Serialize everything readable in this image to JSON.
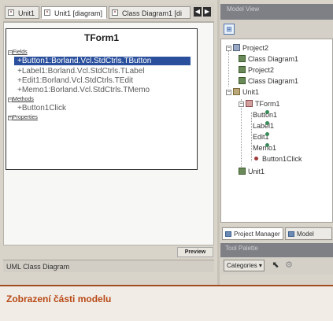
{
  "document_tabs": [
    {
      "label": "Unit1",
      "active": false
    },
    {
      "label": "Unit1 [diagram]",
      "active": true
    },
    {
      "label": "Class Diagram1 [di",
      "active": false
    }
  ],
  "tab_scroll": {
    "left": "◀",
    "right": "▶"
  },
  "class_box": {
    "title": "TForm1",
    "fields_label": "Fields",
    "fields": [
      "+Button1:Borland.Vcl.StdCtrls.TButton",
      "+Label1:Borland.Vcl.StdCtrls.TLabel",
      "+Edit1:Borland.Vcl.StdCtrls.TEdit",
      "+Memo1:Borland.Vcl.StdCtrls.TMemo"
    ],
    "methods_label": "Methods",
    "methods": [
      "+Button1Click"
    ],
    "properties_label": "Properties"
  },
  "preview_label": "Preview",
  "status_left": "UML Class Diagram",
  "right_panel": {
    "header": "Model View",
    "tree": [
      {
        "label": "Project2",
        "icon": "project-icon"
      },
      {
        "label": "Class Diagram1",
        "icon": "diagram-icon"
      },
      {
        "label": "Project2",
        "icon": "diagram-icon"
      },
      {
        "label": "Class Diagram1",
        "icon": "diagram-icon"
      },
      {
        "label": "Unit1",
        "icon": "unit-icon"
      },
      {
        "label": "TForm1",
        "icon": "form-icon"
      },
      {
        "label": "Button1",
        "icon": "field-icon"
      },
      {
        "label": "Label1",
        "icon": "field-icon"
      },
      {
        "label": "Edit1",
        "icon": "field-icon"
      },
      {
        "label": "Memo1",
        "icon": "field-icon"
      },
      {
        "label": "Button1Click",
        "icon": "method-icon"
      },
      {
        "label": "Unit1",
        "icon": "diagram-icon"
      }
    ],
    "tabs": [
      {
        "label": "Project Manager"
      },
      {
        "label": "Model"
      }
    ]
  },
  "tool_palette": {
    "header": "Tool Palette",
    "categories_label": "Categories ▾"
  },
  "caption": "Zobrazení části modelu",
  "colors": {
    "accent": "#b84a17",
    "selection": "#2a4f9c"
  }
}
